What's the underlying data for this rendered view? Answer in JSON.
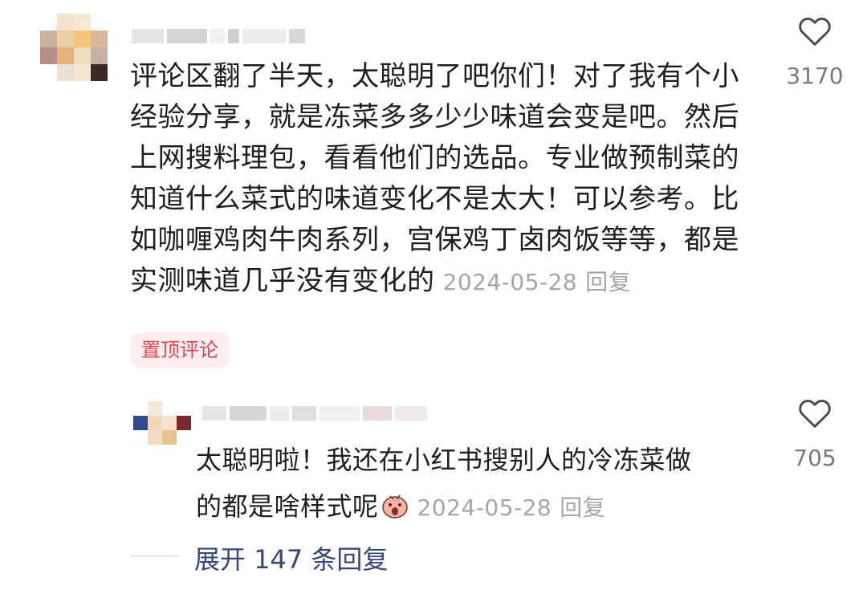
{
  "comment": {
    "lines": [
      "评论区翻了半天，太聪明了吧你们！对了我有个小",
      "经验分享，就是冻菜多多少少味道会变是吧。然后",
      "上网搜料理包，看看他们的选品。专业做预制菜的",
      "知道什么菜式的味道变化不是太大！可以参考。比",
      "如咖喱鸡肉牛肉系列，宫保鸡丁卤肉饭等等，都是",
      "实测味道几乎没有变化的"
    ],
    "date": "2024-05-28",
    "reply_label": "回复",
    "likes": "3170",
    "pin_label": "置顶评论"
  },
  "reply": {
    "lines": [
      "太聪明啦！我还在小红书搜别人的冷冻菜做",
      "的都是啥样式呢"
    ],
    "date": "2024-05-28",
    "reply_label": "回复",
    "likes": "705"
  },
  "expand_label": "展开 147 条回复",
  "icons": {
    "like": "heart-outline-icon",
    "emoji": "surprised-face-emoji-icon"
  },
  "colors": {
    "pin_badge_text": "#e1454f",
    "pin_badge_bg": "#fdeef0",
    "expand_link": "#35487a",
    "meta_gray": "#a6a6a6"
  }
}
